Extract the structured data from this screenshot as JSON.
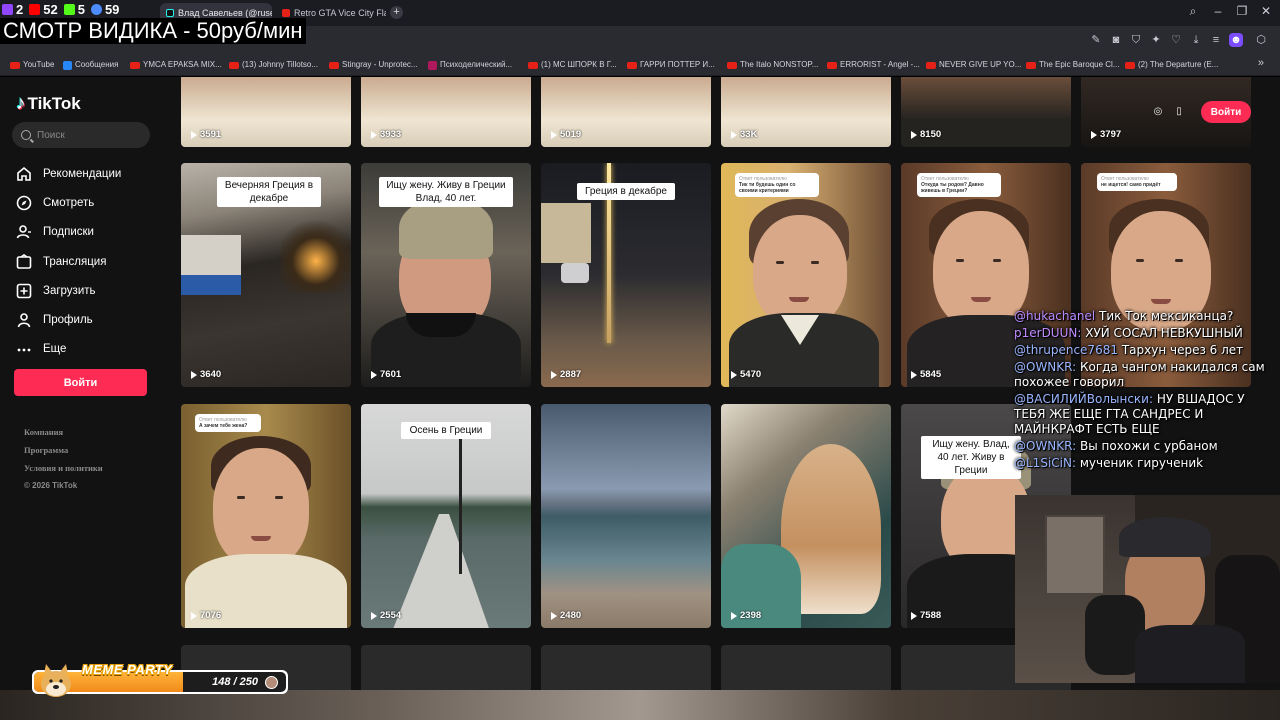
{
  "stream": {
    "title": "СМОТР ВИДИКА - 50руб/мин",
    "stats": [
      {
        "icon": "viewers-icon",
        "value": "2",
        "color": "#9146ff"
      },
      {
        "icon": "youtube-icon",
        "value": "52",
        "color": "#ff0000"
      },
      {
        "icon": "kick-icon",
        "value": "5",
        "color": "#53fc18"
      },
      {
        "icon": "vk-play-icon",
        "value": "59",
        "color": "#4c8cff"
      }
    ]
  },
  "browser": {
    "tabs": [
      {
        "label": "Влад Савельев (@rusev...",
        "active": true
      },
      {
        "label": "Retro GTA Vice City Flash",
        "active": false
      }
    ],
    "bookmarks": [
      {
        "label": "YouTube",
        "icon": "youtube-icon"
      },
      {
        "label": "Сообщения",
        "icon": "vk-icon"
      },
      {
        "label": "YMCA ЕРАКSА MIX...",
        "icon": "youtube-icon"
      },
      {
        "label": "(13) Johnny Tillotso...",
        "icon": "youtube-icon"
      },
      {
        "label": "Stingray - Unprotec...",
        "icon": "youtube-icon"
      },
      {
        "label": "Психоделический...",
        "icon": "yandex-music-icon"
      },
      {
        "label": "(1) МС ШПОРК В Г...",
        "icon": "youtube-icon"
      },
      {
        "label": "ГАРРИ ПОТТЕР И...",
        "icon": "youtube-icon"
      },
      {
        "label": "The Italo NONSTOP...",
        "icon": "youtube-icon"
      },
      {
        "label": "ERRORIST - Angel -...",
        "icon": "youtube-icon"
      },
      {
        "label": "NEVER GIVE UP YO...",
        "icon": "youtube-icon"
      },
      {
        "label": "The Epic Baroque Cl...",
        "icon": "youtube-icon"
      },
      {
        "label": "(2) The Departure (E...",
        "icon": "youtube-icon"
      }
    ]
  },
  "tiktok": {
    "logo": "TikTok",
    "search_placeholder": "Поиск",
    "nav": [
      {
        "label": "Рекомендации",
        "icon": "home-icon"
      },
      {
        "label": "Смотреть",
        "icon": "compass-icon"
      },
      {
        "label": "Подписки",
        "icon": "following-icon"
      },
      {
        "label": "Трансляция",
        "icon": "live-icon"
      },
      {
        "label": "Загрузить",
        "icon": "upload-icon"
      },
      {
        "label": "Профиль",
        "icon": "profile-icon"
      },
      {
        "label": "Еще",
        "icon": "more-icon"
      }
    ],
    "login_label": "Войти",
    "footer": {
      "links": [
        "Компания",
        "Программа",
        "Условия и политики"
      ],
      "copyright": "© 2026 TikTok"
    },
    "top_row_views": [
      "3591",
      "3933",
      "5019",
      "33K",
      "8150",
      "3797"
    ],
    "videos": [
      {
        "views": "3640",
        "caption": "Вечерняя Греция в декабре"
      },
      {
        "views": "7601",
        "caption": "Ищу жену. Живу в Греции Влад, 40 лет."
      },
      {
        "views": "2887",
        "caption": "Греция в декабре"
      },
      {
        "views": "5470",
        "caption": "Тик ти будешь один со своими критериями",
        "comment_user": "Ответ пользователю"
      },
      {
        "views": "5845",
        "caption": "Откуда ты родом? Давно живешь в Греции?",
        "comment_user": "Ответ пользователю"
      },
      {
        "views": "",
        "caption": "не ищется! само придёт",
        "comment_user": "Ответ пользователю"
      },
      {
        "views": "7076",
        "caption": "А зачем тебе жена?",
        "comment_user": "Ответ пользователю"
      },
      {
        "views": "2554",
        "caption": "Осень в Греции"
      },
      {
        "views": "2480",
        "caption": ""
      },
      {
        "views": "2398",
        "caption": ""
      },
      {
        "views": "7588",
        "caption": "Ищу жену. Влад, 40 лет. Живу в Греции"
      }
    ]
  },
  "chat": [
    {
      "user": "@hukachanel",
      "text": "Тик Ток мексиканца?",
      "color": "#b98cff"
    },
    {
      "user": "p1erDUUN:",
      "text": "ХУЙ СОСАЛ НЕВКУШНЫЙ",
      "color": "#c08cff"
    },
    {
      "user": "@thrupence7681",
      "text": "Тархун через 6 лет",
      "color": "#9ab6ff"
    },
    {
      "user": "@OWNKR:",
      "text": "Когда чангом накидался сам похожее говорил",
      "color": "#9ab6ff"
    },
    {
      "user": "@ВАСИЛИЙВолынски:",
      "text": "НУ ВШАДОС У ТЕБЯ ЖЕ ЕЩЕ ГТА САНДРЕС И МАЙНКРАФТ ЕСТЬ ЕЩЕ",
      "color": "#9ab6ff"
    },
    {
      "user": "@OWNKR:",
      "text": "Вы похожи с урбаном",
      "color": "#9ab6ff"
    },
    {
      "user": "@L1SiCiN:",
      "text": "мученик гиручениk",
      "color": "#9ab6ff"
    }
  ],
  "meme_party": {
    "label": "MEME PARTY",
    "count_text": "148 / 250",
    "progress": 0.592
  }
}
